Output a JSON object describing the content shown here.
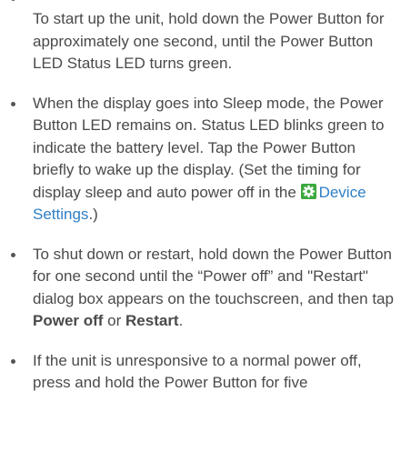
{
  "instructions": {
    "items": [
      {
        "text": "To start up the unit, hold down the Power Button for approximately one second, until the Power Button LED Status LED  turns green."
      },
      {
        "text_before": "When the display goes into Sleep mode, the Power Button LED remains on. Status LED blinks green to indicate the battery level. Tap the Power Button briefly to wake up the display. (Set the timing for display sleep and auto power off in the ",
        "link_text": "Device Settings",
        "text_after": ".)",
        "icon": "settings-gear-icon",
        "icon_color": "#3aa93e"
      },
      {
        "text_before": "To shut down or restart, hold down the Power Button for one second until the “Power off” and \"Restart\" dialog box appears on the touchscreen, and then tap ",
        "bold1": "Power off",
        "text_mid": " or ",
        "bold2": "Restart",
        "text_after": "."
      },
      {
        "text": "If the unit is unresponsive to a normal power off, press and hold the Power Button for five"
      }
    ]
  },
  "colors": {
    "text": "#4a4a4a",
    "link": "#2f7fc4",
    "bullet": "#555555"
  }
}
